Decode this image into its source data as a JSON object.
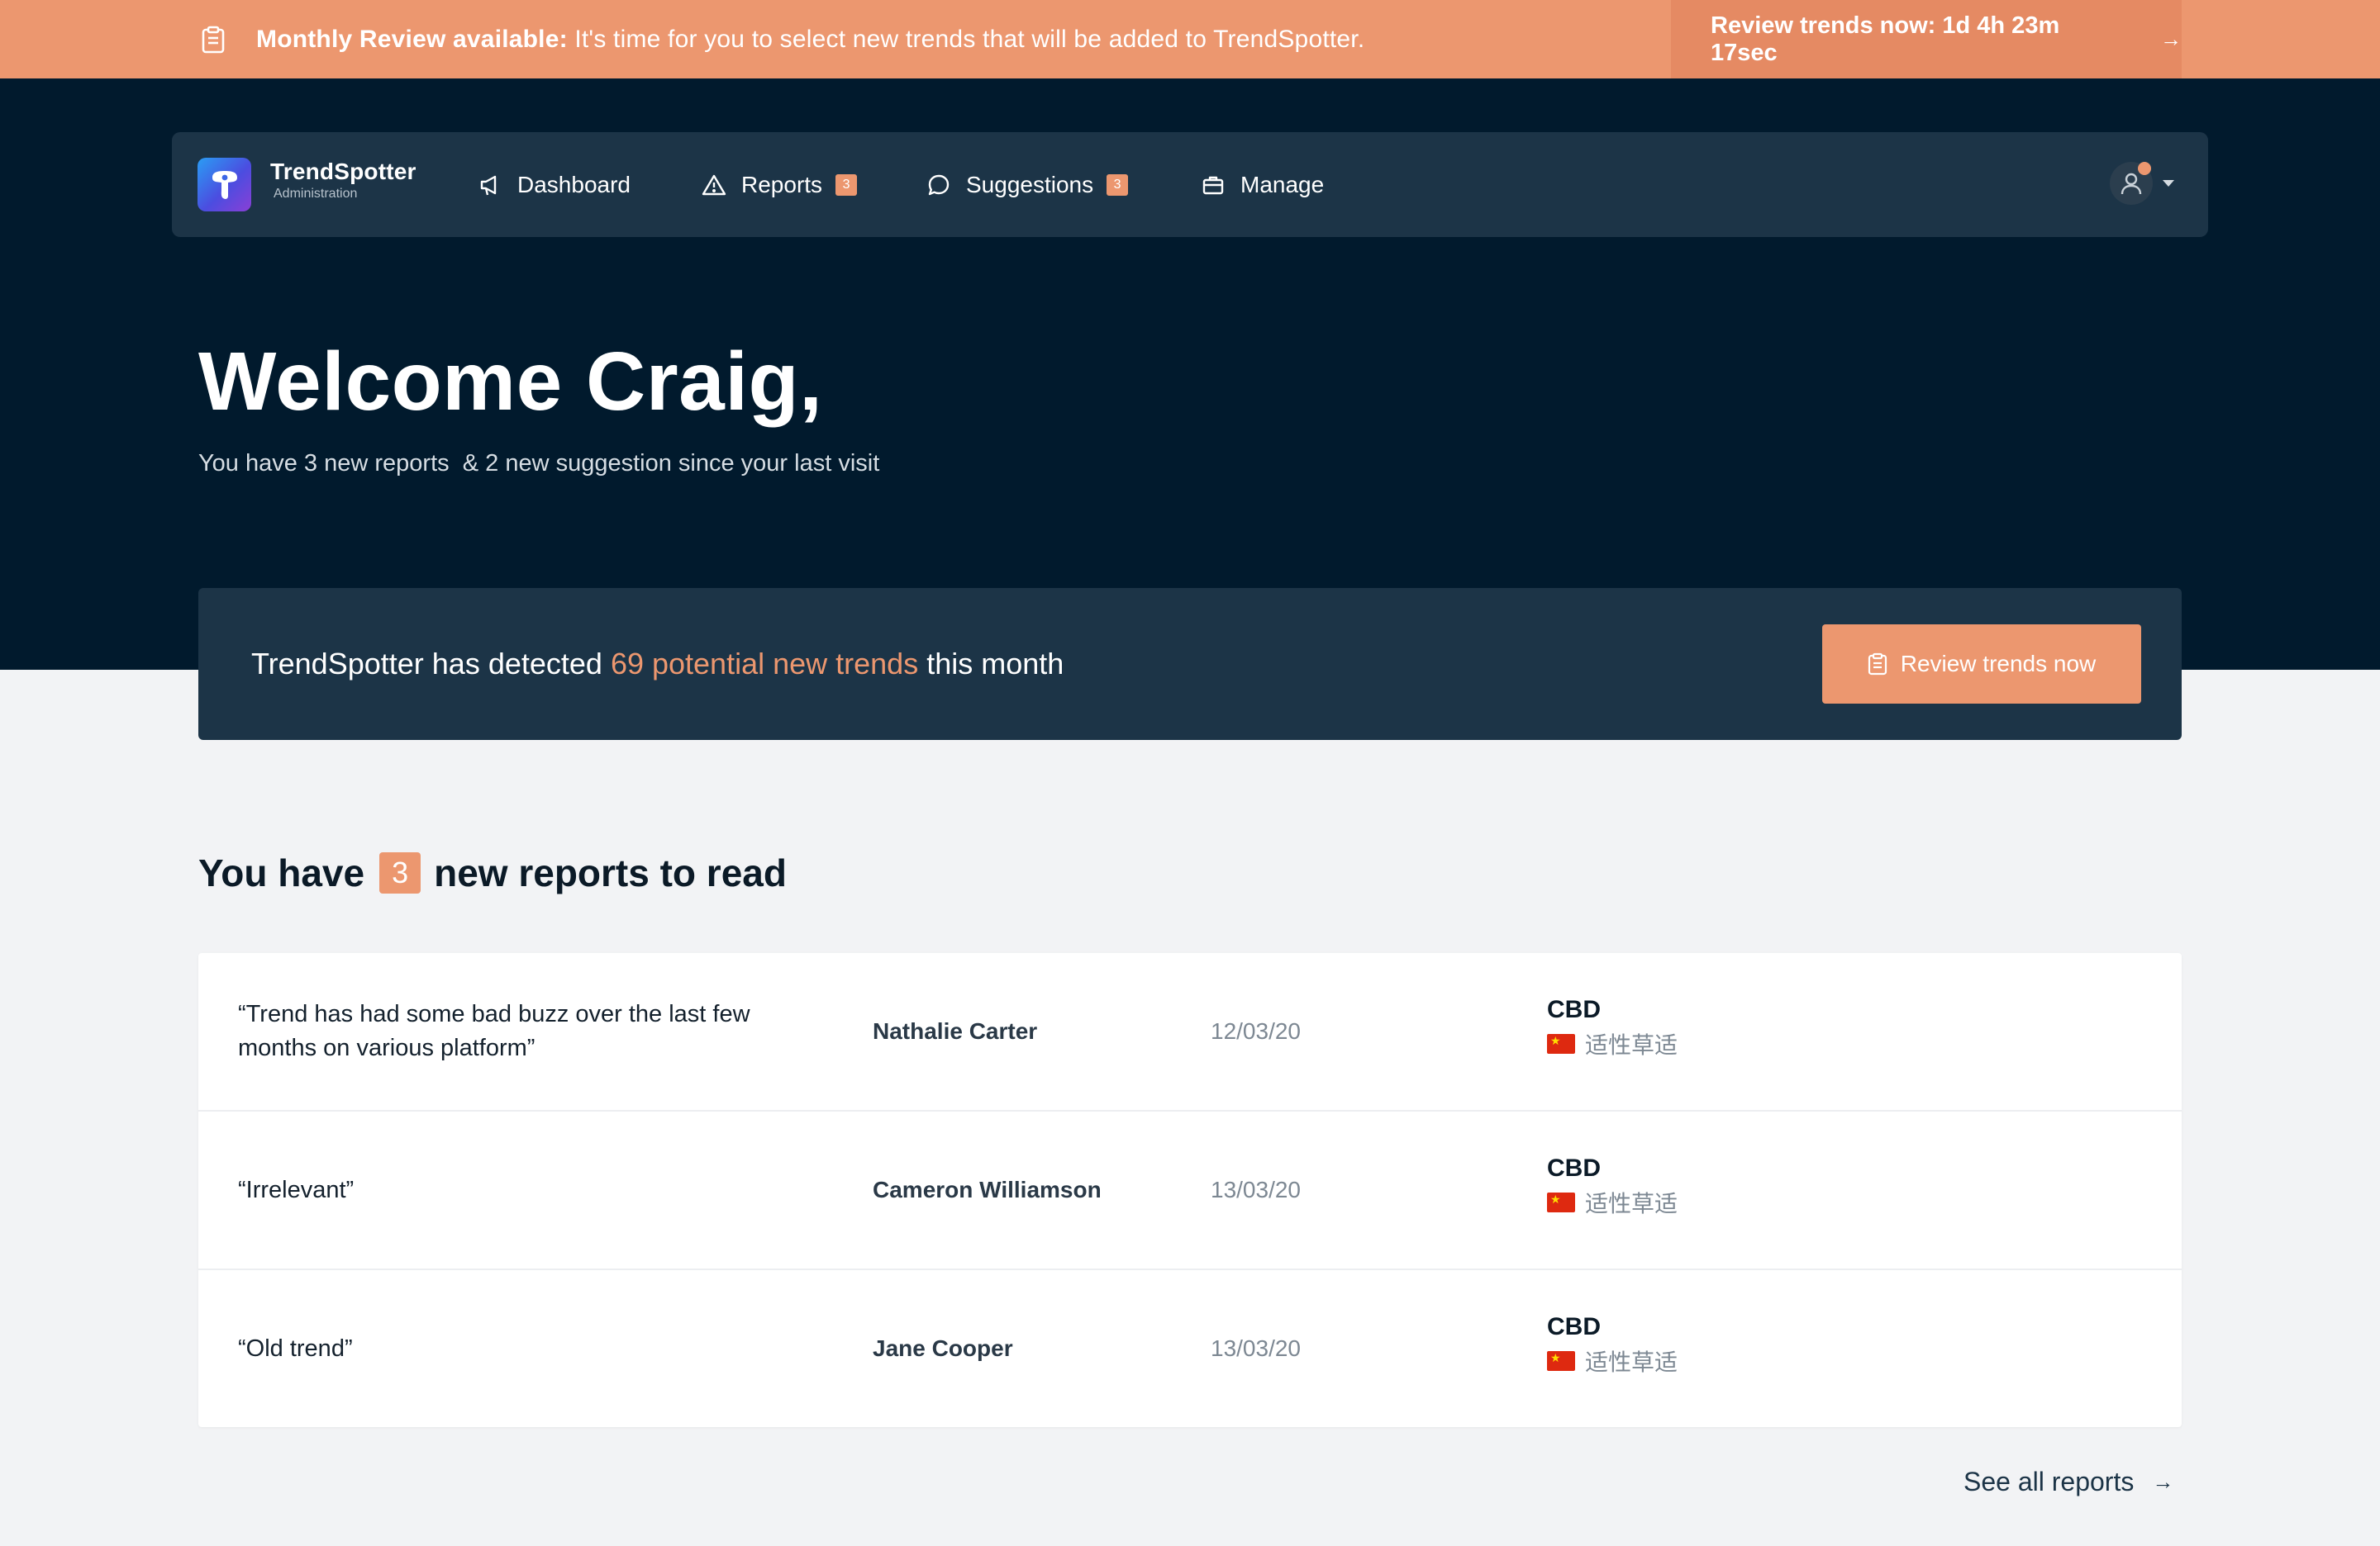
{
  "banner": {
    "title": "Monthly Review available:",
    "message": " It's time for you to select new trends that will be added to TrendSpotter.",
    "cta": "Review trends now: 1d 4h 23m 17sec",
    "icon": "clipboard-icon"
  },
  "nav": {
    "brand": "TrendSpotter",
    "brand_sub": "Administration",
    "items": [
      {
        "label": "Dashboard",
        "icon": "megaphone-icon",
        "badge": ""
      },
      {
        "label": "Reports",
        "icon": "warning-icon",
        "badge": "3"
      },
      {
        "label": "Suggestions",
        "icon": "chat-bubble-icon",
        "badge": "3"
      },
      {
        "label": "Manage",
        "icon": "briefcase-icon",
        "badge": ""
      }
    ]
  },
  "hero": {
    "welcome": "Welcome Craig,",
    "subtitle": "You have 3 new reports  & 2 new suggestion since your last visit"
  },
  "detect": {
    "prefix": "TrendSpotter has detected ",
    "highlight": "69 potential new trends",
    "suffix": " this month",
    "button": "Review trends now"
  },
  "reports": {
    "heading_prefix": "You have",
    "count": "3",
    "heading_suffix": "new reports to read",
    "rows": [
      {
        "quote": "“Trend has had some bad buzz over the last few months on various platform”",
        "author": "Nathalie Carter",
        "date": "12/03/20",
        "trend": "CBD",
        "local": "适性草适"
      },
      {
        "quote": "“Irrelevant”",
        "author": "Cameron Williamson",
        "date": "13/03/20",
        "trend": "CBD",
        "local": "适性草适"
      },
      {
        "quote": "“Old trend”",
        "author": "Jane Cooper",
        "date": "13/03/20",
        "trend": "CBD",
        "local": "适性草适"
      }
    ],
    "see_all": "See all reports"
  },
  "colors": {
    "accent": "#ec976f",
    "navy": "#011a2d",
    "card": "#1c3447"
  }
}
